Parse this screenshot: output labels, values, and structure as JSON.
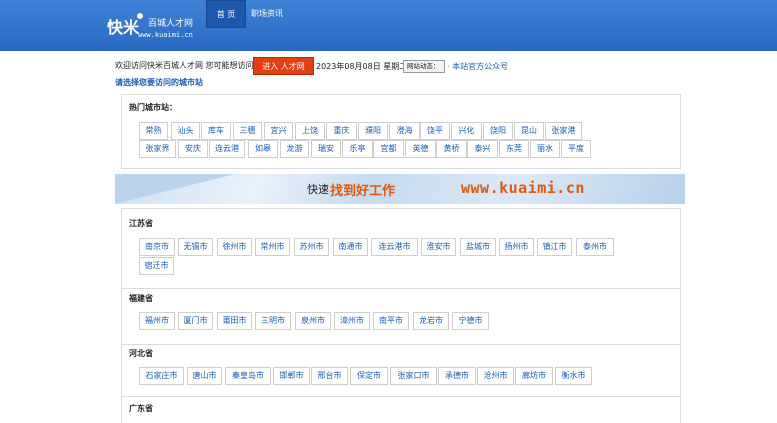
{
  "header": {
    "logo_main": "快米",
    "logo_sub": "百城人才网",
    "logo_url": "www.kuaimi.cn",
    "nav": [
      {
        "label": "首  页"
      },
      {
        "label": "职场资讯"
      }
    ]
  },
  "welcome_bar": {
    "welcome_text": "欢迎访问快米百城人才网 您可能想访问",
    "enter_button": "进入 人才网",
    "date": "2023年08月08日 星期二",
    "news_button": "网站动态：",
    "official_link": "· 本站官方公众号"
  },
  "choose_title": "请选择您要访问的城市站",
  "hot_cities": {
    "title": "热门城市站：",
    "cities": [
      "常熟",
      "汕头",
      "库车",
      "三穗",
      "宜兴",
      "上饶",
      "重庆",
      "濮阳",
      "澄海",
      "饶平",
      "兴化",
      "饶阳",
      "昆山",
      "张家港",
      "张家界",
      "安庆",
      "连云港",
      "如皋",
      "龙游",
      "瑞安",
      "乐亭",
      "宜都",
      "英德",
      "黄桥",
      "泰兴",
      "东莞",
      "丽水",
      "平度"
    ]
  },
  "banner": {
    "tag": "快速",
    "slogan": "找到好工作",
    "url": "www.kuaimi.cn"
  },
  "provinces": [
    {
      "name": "江苏省",
      "cities": [
        "南京市",
        "无锡市",
        "徐州市",
        "常州市",
        "苏州市",
        "南通市",
        "连云港市",
        "淮安市",
        "盐城市",
        "扬州市",
        "镇江市",
        "泰州市",
        "宿迁市"
      ]
    },
    {
      "name": "福建省",
      "cities": [
        "福州市",
        "厦门市",
        "莆田市",
        "三明市",
        "泉州市",
        "漳州市",
        "南平市",
        "龙岩市",
        "宁德市"
      ]
    },
    {
      "name": "河北省",
      "cities": [
        "石家庄市",
        "唐山市",
        "秦皇岛市",
        "邯郸市",
        "邢台市",
        "保定市",
        "张家口市",
        "承德市",
        "沧州市",
        "廊坊市",
        "衡水市"
      ]
    },
    {
      "name": "广东省",
      "cities": []
    }
  ],
  "colors": {
    "header": "#2f72cc",
    "link": "#1a5db8",
    "accent": "#e23f12",
    "banner_text": "#e05a0a"
  }
}
